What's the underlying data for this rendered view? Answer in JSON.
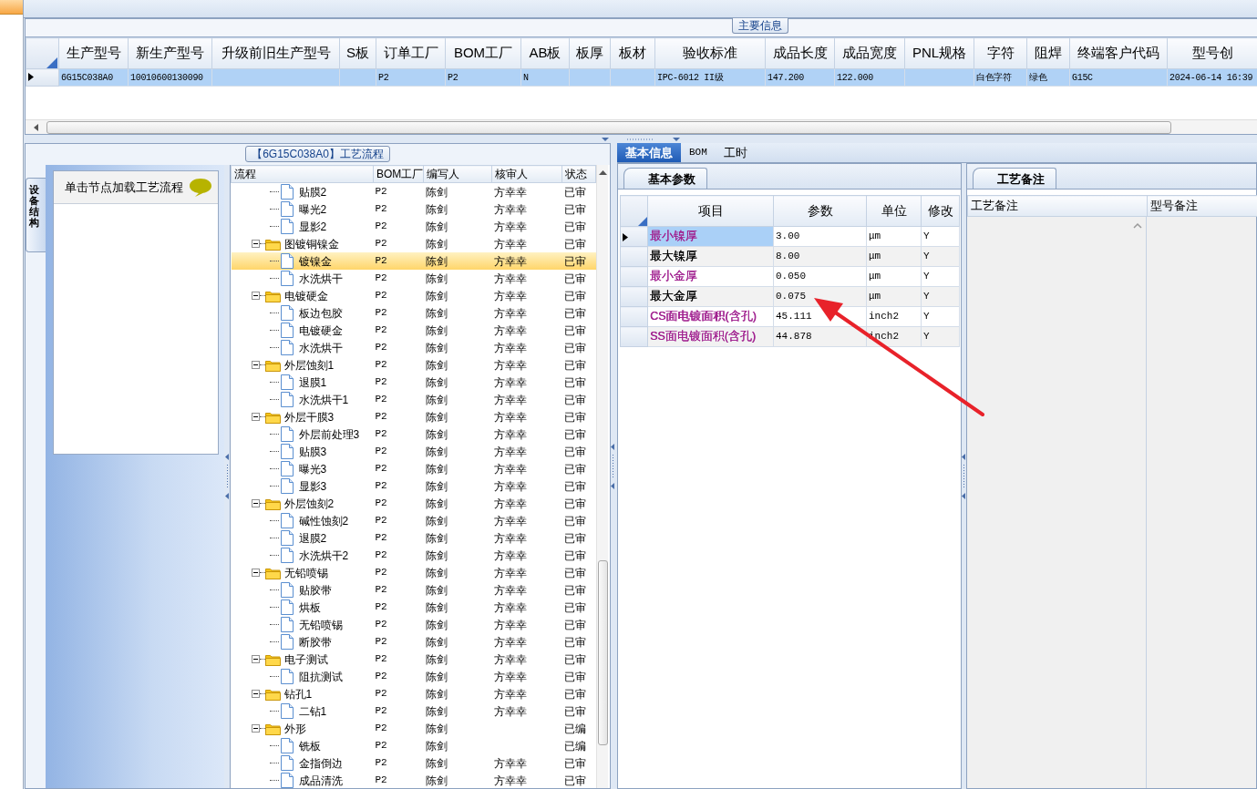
{
  "main_info": {
    "title": "主要信息",
    "columns": [
      "生产型号",
      "新生产型号",
      "升级前旧生产型号",
      "S板",
      "订单工厂",
      "BOM工厂",
      "AB板",
      "板厚",
      "板材",
      "验收标准",
      "成品长度",
      "成品宽度",
      "PNL规格",
      "字符",
      "阻焊",
      "终端客户代码",
      "型号创"
    ],
    "rows": [
      {
        "selected": true,
        "cells": [
          "6G15C038A0",
          "10010600130090",
          null,
          null,
          "P2",
          "P2",
          "N",
          null,
          null,
          "IPC-6012 II级",
          "147.200",
          "122.000",
          null,
          "白色字符",
          "绿色",
          "G15C",
          "2024-06-14 16:39"
        ]
      }
    ]
  },
  "process_panel": {
    "title": "【6G15C038A0】工艺流程",
    "side_tab": "设备结构",
    "node_hint": "单击节点加载工艺流程",
    "tree": {
      "columns": [
        "流程",
        "BOM工厂",
        "编写人",
        "核审人",
        "状态"
      ],
      "items": [
        {
          "children": [
            {
              "label": "贴膜2",
              "bom": "P2",
              "writer": "陈剑",
              "reviewer": "方幸幸",
              "status": "已审",
              "selected": false
            },
            {
              "label": "曝光2",
              "bom": "P2",
              "writer": "陈剑",
              "reviewer": "方幸幸",
              "status": "已审",
              "selected": false
            },
            {
              "label": "显影2",
              "bom": "P2",
              "writer": "陈剑",
              "reviewer": "方幸幸",
              "status": "已审",
              "selected": false
            }
          ]
        },
        {
          "label": "图镀铜镍金",
          "bom": "P2",
          "writer": "陈剑",
          "reviewer": "方幸幸",
          "status": "已审",
          "selected": false,
          "expanded": true,
          "children": [
            {
              "label": "镀镍金",
              "bom": "P2",
              "writer": "陈剑",
              "reviewer": "方幸幸",
              "status": "已审",
              "selected": true
            },
            {
              "label": "水洗烘干",
              "bom": "P2",
              "writer": "陈剑",
              "reviewer": "方幸幸",
              "status": "已审",
              "selected": false
            }
          ]
        },
        {
          "label": "电镀硬金",
          "bom": "P2",
          "writer": "陈剑",
          "reviewer": "方幸幸",
          "status": "已审",
          "selected": false,
          "expanded": true,
          "children": [
            {
              "label": "板边包胶",
              "bom": "P2",
              "writer": "陈剑",
              "reviewer": "方幸幸",
              "status": "已审",
              "selected": false
            },
            {
              "label": "电镀硬金",
              "bom": "P2",
              "writer": "陈剑",
              "reviewer": "方幸幸",
              "status": "已审",
              "selected": false
            },
            {
              "label": "水洗烘干",
              "bom": "P2",
              "writer": "陈剑",
              "reviewer": "方幸幸",
              "status": "已审",
              "selected": false
            }
          ]
        },
        {
          "label": "外层蚀刻1",
          "bom": "P2",
          "writer": "陈剑",
          "reviewer": "方幸幸",
          "status": "已审",
          "selected": false,
          "expanded": true,
          "children": [
            {
              "label": "退膜1",
              "bom": "P2",
              "writer": "陈剑",
              "reviewer": "方幸幸",
              "status": "已审",
              "selected": false
            },
            {
              "label": "水洗烘干1",
              "bom": "P2",
              "writer": "陈剑",
              "reviewer": "方幸幸",
              "status": "已审",
              "selected": false
            }
          ]
        },
        {
          "label": "外层干膜3",
          "bom": "P2",
          "writer": "陈剑",
          "reviewer": "方幸幸",
          "status": "已审",
          "selected": false,
          "expanded": true,
          "children": [
            {
              "label": "外层前处理3",
              "bom": "P2",
              "writer": "陈剑",
              "reviewer": "方幸幸",
              "status": "已审",
              "selected": false
            },
            {
              "label": "贴膜3",
              "bom": "P2",
              "writer": "陈剑",
              "reviewer": "方幸幸",
              "status": "已审",
              "selected": false
            },
            {
              "label": "曝光3",
              "bom": "P2",
              "writer": "陈剑",
              "reviewer": "方幸幸",
              "status": "已审",
              "selected": false
            },
            {
              "label": "显影3",
              "bom": "P2",
              "writer": "陈剑",
              "reviewer": "方幸幸",
              "status": "已审",
              "selected": false
            }
          ]
        },
        {
          "label": "外层蚀刻2",
          "bom": "P2",
          "writer": "陈剑",
          "reviewer": "方幸幸",
          "status": "已审",
          "selected": false,
          "expanded": true,
          "children": [
            {
              "label": "碱性蚀刻2",
              "bom": "P2",
              "writer": "陈剑",
              "reviewer": "方幸幸",
              "status": "已审",
              "selected": false
            },
            {
              "label": "退膜2",
              "bom": "P2",
              "writer": "陈剑",
              "reviewer": "方幸幸",
              "status": "已审",
              "selected": false
            },
            {
              "label": "水洗烘干2",
              "bom": "P2",
              "writer": "陈剑",
              "reviewer": "方幸幸",
              "status": "已审",
              "selected": false
            }
          ]
        },
        {
          "label": "无铅喷锡",
          "bom": "P2",
          "writer": "陈剑",
          "reviewer": "方幸幸",
          "status": "已审",
          "selected": false,
          "expanded": true,
          "children": [
            {
              "label": "贴胶带",
              "bom": "P2",
              "writer": "陈剑",
              "reviewer": "方幸幸",
              "status": "已审",
              "selected": false
            },
            {
              "label": "烘板",
              "bom": "P2",
              "writer": "陈剑",
              "reviewer": "方幸幸",
              "status": "已审",
              "selected": false
            },
            {
              "label": "无铅喷锡",
              "bom": "P2",
              "writer": "陈剑",
              "reviewer": "方幸幸",
              "status": "已审",
              "selected": false
            },
            {
              "label": "断胶带",
              "bom": "P2",
              "writer": "陈剑",
              "reviewer": "方幸幸",
              "status": "已审",
              "selected": false
            }
          ]
        },
        {
          "label": "电子测试",
          "bom": "P2",
          "writer": "陈剑",
          "reviewer": "方幸幸",
          "status": "已审",
          "selected": false,
          "expanded": true,
          "children": [
            {
              "label": "阻抗测试",
              "bom": "P2",
              "writer": "陈剑",
              "reviewer": "方幸幸",
              "status": "已审",
              "selected": false
            }
          ]
        },
        {
          "label": "钻孔1",
          "bom": "P2",
          "writer": "陈剑",
          "reviewer": "方幸幸",
          "status": "已审",
          "selected": false,
          "expanded": true,
          "children": [
            {
              "label": "二钻1",
              "bom": "P2",
              "writer": "陈剑",
              "reviewer": "方幸幸",
              "status": "已审",
              "selected": false
            }
          ]
        },
        {
          "label": "外形",
          "bom": "P2",
          "writer": "陈剑",
          "status": "已编",
          "selected": false,
          "expanded": true,
          "children": [
            {
              "label": "铣板",
              "bom": "P2",
              "writer": "陈剑",
              "status": "已编",
              "selected": false
            },
            {
              "label": "金指倒边",
              "bom": "P2",
              "writer": "陈剑",
              "reviewer": "方幸幸",
              "status": "已审",
              "selected": false
            },
            {
              "label": "成品清洗",
              "bom": "P2",
              "writer": "陈剑",
              "reviewer": "方幸幸",
              "status": "已审",
              "selected": false
            }
          ]
        }
      ]
    }
  },
  "detail_tabs": [
    {
      "label": "基本信息",
      "selected": true
    },
    {
      "label": "BOM",
      "selected": false
    },
    {
      "label": "工时",
      "selected": false
    }
  ],
  "params": {
    "tab": "基本参数",
    "columns": [
      "项目",
      "参数",
      "单位",
      "修改"
    ],
    "rows": [
      {
        "item": "最小镍厚",
        "value": "3.00",
        "unit": "μm",
        "modified": "Y",
        "color": "#a0208f",
        "selected": true
      },
      {
        "item": "最大镍厚",
        "value": "8.00",
        "unit": "μm",
        "modified": "Y",
        "color": "#000000",
        "selected": false
      },
      {
        "item": "最小金厚",
        "value": "0.050",
        "unit": "μm",
        "modified": "Y",
        "color": "#a0208f",
        "selected": false
      },
      {
        "item": "最大金厚",
        "value": "0.075",
        "unit": "μm",
        "modified": "Y",
        "color": "#000000",
        "selected": false
      },
      {
        "item": "CS面电镀面积(含孔)",
        "value": "45.111",
        "unit": "inch2",
        "modified": "Y",
        "color": "#a0208f",
        "selected": false
      },
      {
        "item": "SS面电镀面积(含孔)",
        "value": "44.878",
        "unit": "inch2",
        "modified": "Y",
        "color": "#a0208f",
        "selected": false
      }
    ]
  },
  "remarks": {
    "tab": "工艺备注",
    "columns": [
      "工艺备注",
      "型号备注"
    ]
  }
}
